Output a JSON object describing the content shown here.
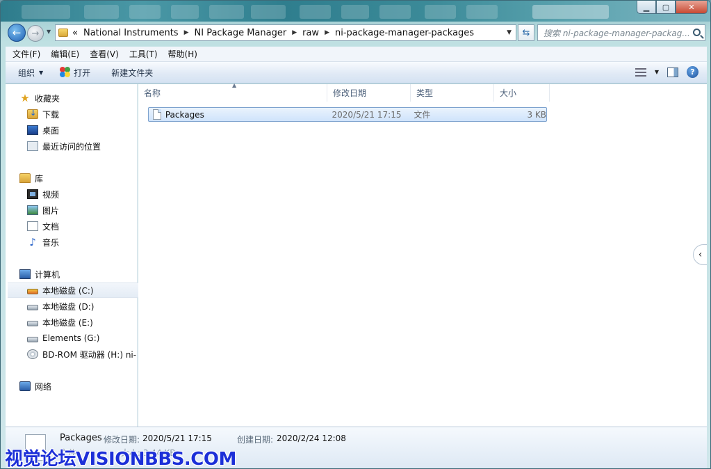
{
  "address": {
    "crumbs": [
      "«",
      "National Instruments",
      "NI Package Manager",
      "raw",
      "ni-package-manager-packages"
    ],
    "search_placeholder": "搜索 ni-package-manager-packag..."
  },
  "menu": [
    "文件(F)",
    "编辑(E)",
    "查看(V)",
    "工具(T)",
    "帮助(H)"
  ],
  "commands": {
    "organize": "组织",
    "open": "打开",
    "new_folder": "新建文件夹"
  },
  "nav": {
    "favorites": "收藏夹",
    "downloads": "下载",
    "desktop": "桌面",
    "recent": "最近访问的位置",
    "library": "库",
    "videos": "视频",
    "pictures": "图片",
    "documents": "文档",
    "music": "音乐",
    "computer": "计算机",
    "drive_c": "本地磁盘 (C:)",
    "drive_d": "本地磁盘 (D:)",
    "drive_e": "本地磁盘 (E:)",
    "drive_g": "Elements (G:)",
    "drive_h": "BD-ROM 驱动器 (H:) ni-",
    "network": "网络"
  },
  "columns": {
    "name": "名称",
    "date": "修改日期",
    "type": "类型",
    "size": "大小"
  },
  "files": [
    {
      "name": "Packages",
      "date": "2020/5/21 17:15",
      "type": "文件",
      "size": "3 KB"
    }
  ],
  "details": {
    "name": "Packages",
    "modified_label": "修改日期:",
    "modified_value": "2020/5/21 17:15",
    "created_label": "创建日期:",
    "created_value": "2020/2/24 12:08",
    "type_line": "文件",
    "size_line": "大小: 3.44 KB"
  },
  "watermark": "视觉论坛VISIONBBS.COM"
}
